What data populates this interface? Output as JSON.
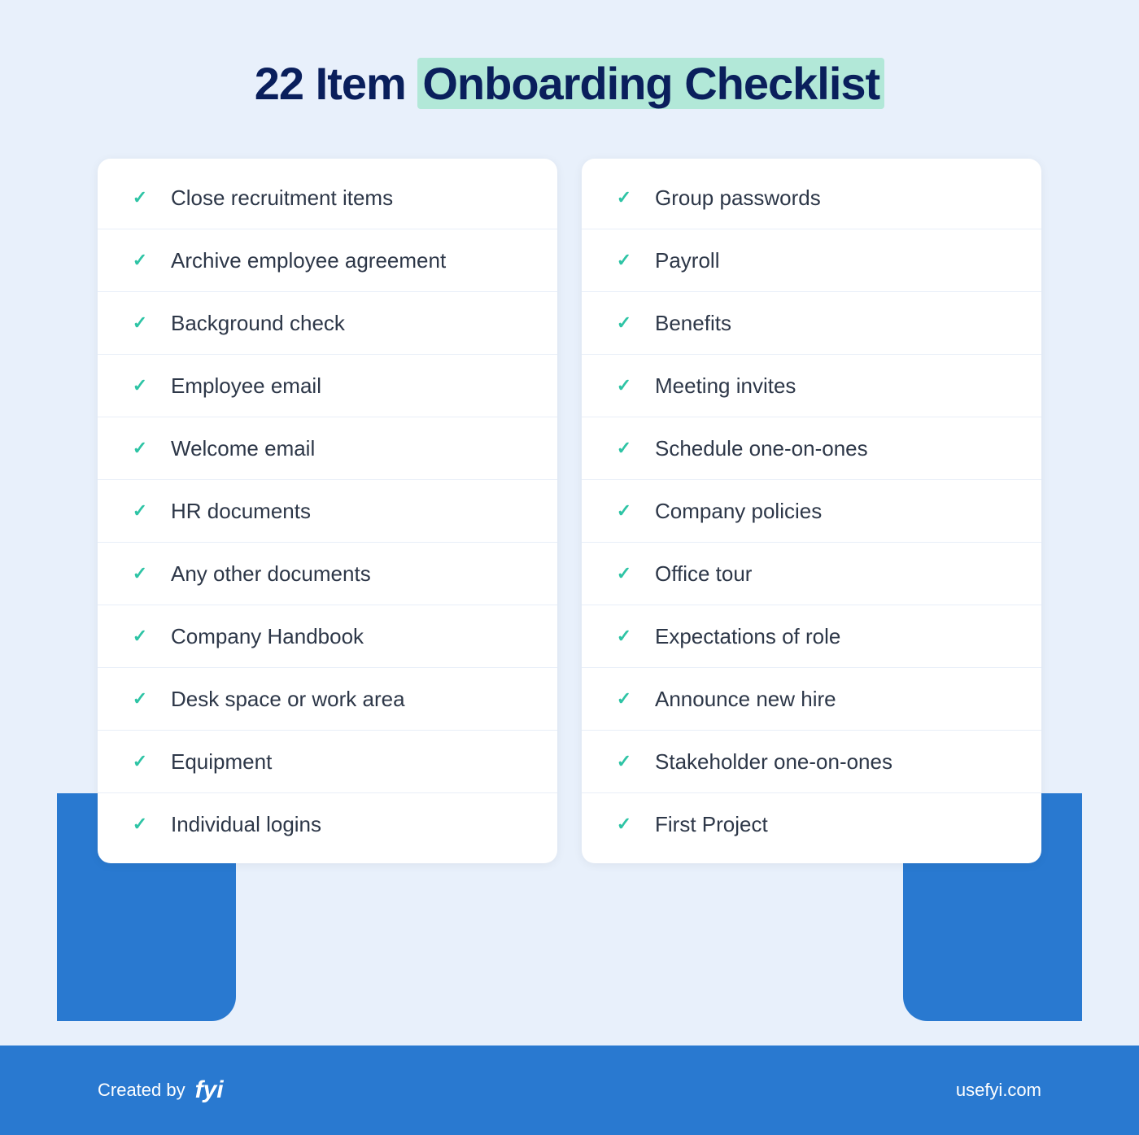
{
  "header": {
    "title_prefix": "22 Item ",
    "title_highlight": "Onboarding Checklist"
  },
  "left_column": {
    "items": [
      "Close recruitment items",
      "Archive employee agreement",
      "Background check",
      "Employee email",
      "Welcome email",
      "HR documents",
      "Any other documents",
      "Company Handbook",
      "Desk space or work area",
      "Equipment",
      "Individual logins"
    ]
  },
  "right_column": {
    "items": [
      "Group passwords",
      "Payroll",
      "Benefits",
      "Meeting invites",
      "Schedule one-on-ones",
      "Company policies",
      "Office tour",
      "Expectations of role",
      "Announce new hire",
      "Stakeholder one-on-ones",
      "First Project"
    ]
  },
  "footer": {
    "created_by_label": "Created by",
    "brand_name": "fyi",
    "url": "usefyi.com"
  },
  "check_symbol": "✓",
  "accent_color": "#2ec4a5",
  "title_color": "#0a1f5c"
}
